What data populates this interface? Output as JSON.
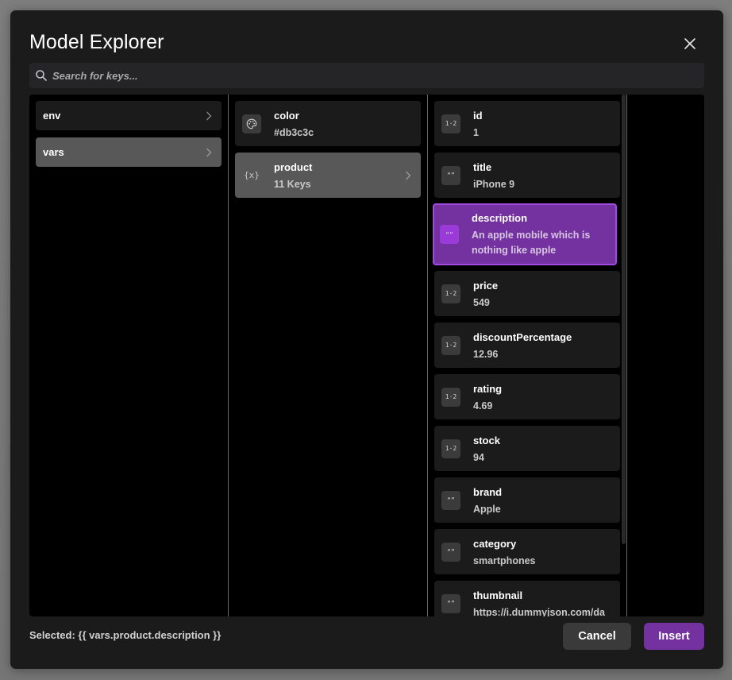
{
  "modal": {
    "title": "Model Explorer",
    "close_icon": "close-icon"
  },
  "search": {
    "placeholder": "Search for keys...",
    "value": "",
    "icon": "search-icon"
  },
  "columns": {
    "root": [
      {
        "label": "env",
        "has_children": true,
        "active": false
      },
      {
        "label": "vars",
        "has_children": true,
        "active": true
      }
    ],
    "vars": [
      {
        "key": "color",
        "value": "#db3c3c",
        "icon": "palette-icon",
        "type": "color",
        "has_children": false,
        "active": false
      },
      {
        "key": "product",
        "value": "11 Keys",
        "icon": "object-icon",
        "type": "object",
        "has_children": true,
        "active": true
      }
    ],
    "product": [
      {
        "key": "id",
        "value": "1",
        "icon": "number-icon",
        "type": "number"
      },
      {
        "key": "title",
        "value": "iPhone 9",
        "icon": "string-icon",
        "type": "string"
      },
      {
        "key": "description",
        "value": "An apple mobile which is nothing like apple",
        "icon": "string-icon",
        "type": "string",
        "selected": true
      },
      {
        "key": "price",
        "value": "549",
        "icon": "number-icon",
        "type": "number"
      },
      {
        "key": "discountPercentage",
        "value": "12.96",
        "icon": "number-icon",
        "type": "number"
      },
      {
        "key": "rating",
        "value": "4.69",
        "icon": "number-icon",
        "type": "number"
      },
      {
        "key": "stock",
        "value": "94",
        "icon": "number-icon",
        "type": "number"
      },
      {
        "key": "brand",
        "value": "Apple",
        "icon": "string-icon",
        "type": "string"
      },
      {
        "key": "category",
        "value": "smartphones",
        "icon": "string-icon",
        "type": "string"
      },
      {
        "key": "thumbnail",
        "value": "https://i.dummyjson.com/da",
        "icon": "string-icon",
        "type": "string"
      }
    ]
  },
  "icon_glyphs": {
    "number": "1·2",
    "string": "“”",
    "object": "{x}"
  },
  "footer": {
    "selected_text": "Selected: {{ vars.product.description }}",
    "cancel_label": "Cancel",
    "insert_label": "Insert"
  },
  "colors": {
    "accent": "#7432a0",
    "accent_border": "#a04be0",
    "modal_bg": "#1b1b1b",
    "pane_bg": "#000000",
    "active_item": "#585858"
  }
}
